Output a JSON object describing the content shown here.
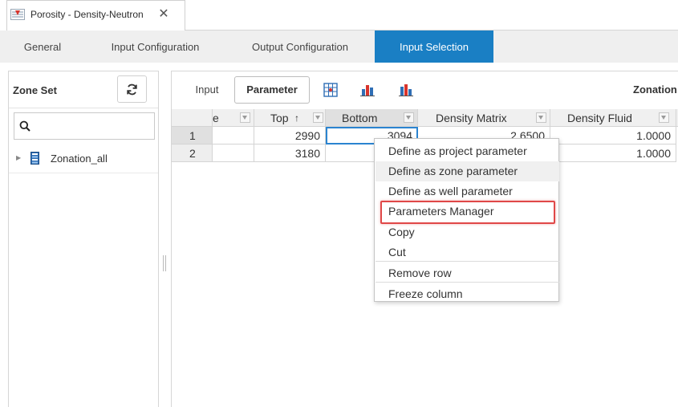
{
  "document_tab": {
    "title": "Porosity - Density-Neutron",
    "close_symbol": "✕"
  },
  "tabs": [
    {
      "label": "General",
      "active": false
    },
    {
      "label": "Input Configuration",
      "active": false
    },
    {
      "label": "Output Configuration",
      "active": false
    },
    {
      "label": "Input Selection",
      "active": true
    }
  ],
  "zone_panel": {
    "title": "Zone Set",
    "refresh_icon": "refresh-icon",
    "search": {
      "value": "",
      "placeholder": "",
      "icon": "search-icon"
    },
    "tree": [
      {
        "label": "Zonation_all",
        "icon": "zone-set-icon",
        "expanded": false
      }
    ]
  },
  "toolbar": {
    "input_label": "Input",
    "parameter_label": "Parameter",
    "icons": [
      "grid-columns-icon",
      "bar-chart-icon",
      "bar-chart-alt-icon"
    ],
    "zonation_label": "Zonation"
  },
  "grid": {
    "columns": [
      {
        "label": "e",
        "filter": true
      },
      {
        "label": "Top",
        "sort": "↑",
        "filter": true
      },
      {
        "label": "Bottom",
        "filter": true,
        "selected": true
      },
      {
        "label": "Density Matrix",
        "filter": true
      },
      {
        "label": "Density Fluid",
        "filter": true
      }
    ],
    "rows": [
      {
        "index": "1",
        "top": "2990",
        "bottom": "3094",
        "density_matrix": "2.6500",
        "density_fluid": "1.0000"
      },
      {
        "index": "2",
        "top": "3180",
        "bottom": "",
        "density_matrix": "",
        "density_fluid": "1.0000"
      }
    ]
  },
  "context_menu": {
    "items": [
      {
        "label": "Define as project parameter"
      },
      {
        "label": "Define as zone parameter",
        "hovered": true
      },
      {
        "label": "Define as well parameter"
      },
      {
        "label": "Parameters Manager",
        "highlighted": true
      },
      {
        "label": "Copy"
      },
      {
        "label": "Cut"
      },
      {
        "label": "Remove row"
      },
      {
        "label": "Freeze column"
      }
    ]
  },
  "colors": {
    "accent": "#1a7fc4",
    "highlight_border": "#e04848",
    "tab_bar_bg": "#efefef"
  }
}
